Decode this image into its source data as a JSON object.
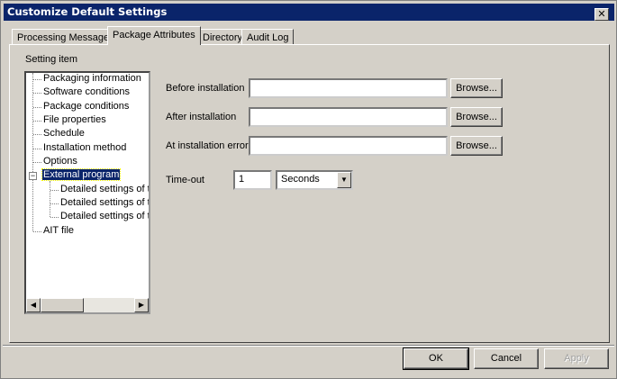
{
  "window": {
    "title": "Customize Default Settings",
    "close": "✕"
  },
  "tabs": [
    {
      "label": "Processing Message"
    },
    {
      "label": "Package Attributes",
      "active": true
    },
    {
      "label": "Directory"
    },
    {
      "label": "Audit Log"
    }
  ],
  "setting_item_label": "Setting item",
  "tree": {
    "items": [
      "Packaging information",
      "Software conditions",
      "Package conditions",
      "File properties",
      "Schedule",
      "Installation method",
      "Options",
      "External program",
      "Detailed settings of th",
      "Detailed settings of th",
      "Detailed settings of th",
      "AIT file"
    ],
    "selected": "External program",
    "expander": "−"
  },
  "fields": {
    "before": {
      "label": "Before installation",
      "value": "",
      "browse": "Browse..."
    },
    "after": {
      "label": "After installation",
      "value": "",
      "browse": "Browse..."
    },
    "error": {
      "label": "At installation error",
      "value": "",
      "browse": "Browse..."
    },
    "timeout": {
      "label": "Time-out",
      "value": "1",
      "unit": "Seconds"
    }
  },
  "buttons": {
    "ok": "OK",
    "cancel": "Cancel",
    "apply": "Apply"
  }
}
